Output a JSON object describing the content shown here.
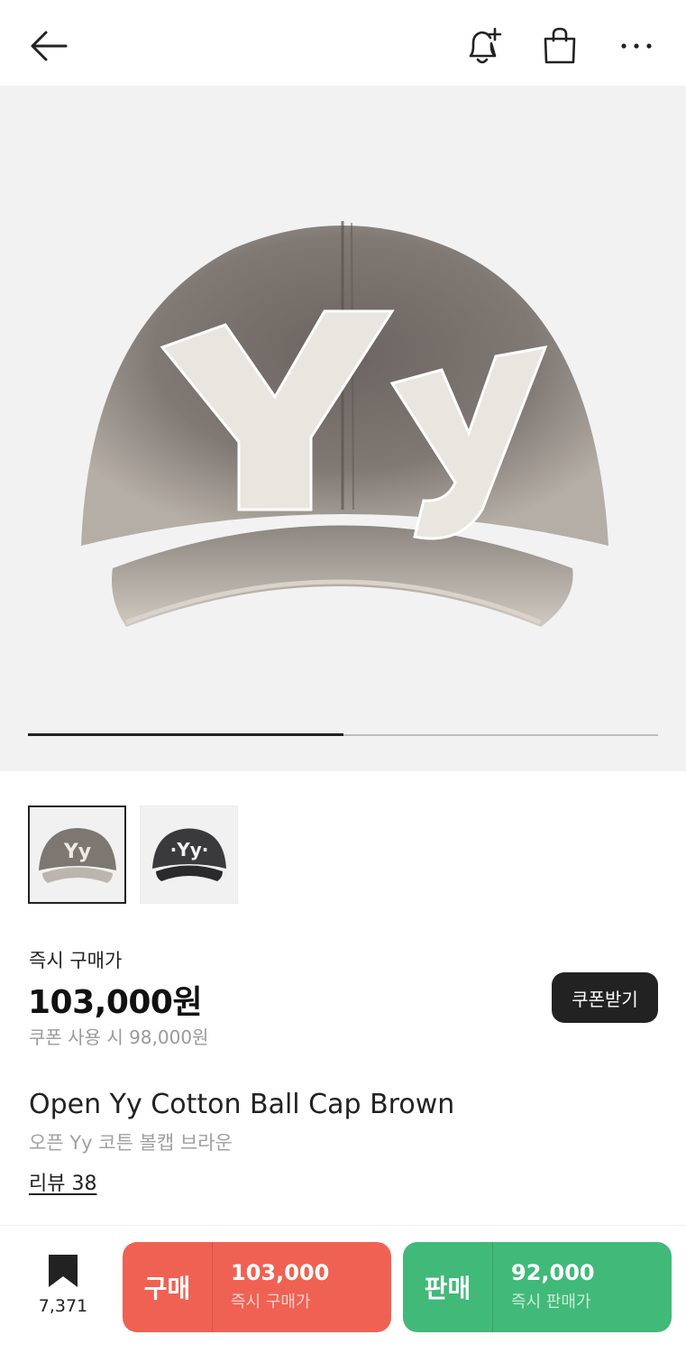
{
  "header": {
    "back_icon": "arrow-left-icon",
    "alert_icon": "bell-plus-icon",
    "cart_icon": "shopping-bag-icon",
    "more_icon": "more-dots-icon"
  },
  "gallery": {
    "progress": 0.5,
    "thumbnails": [
      {
        "name": "washed-gray-cap",
        "selected": true
      },
      {
        "name": "black-cap",
        "selected": false
      }
    ]
  },
  "price": {
    "label": "즉시 구매가",
    "amount": "103,000원",
    "coupon_text": "쿠폰 사용 시 98,000원",
    "coupon_button": "쿠폰받기"
  },
  "product": {
    "title_en": "Open Yy Cotton Ball Cap Brown",
    "title_ko": "오픈 Yy 코튼 볼캡 브라운",
    "review_link": "리뷰 38"
  },
  "bottom_bar": {
    "bookmark_count": "7,371",
    "buy": {
      "kind": "구매",
      "amount": "103,000",
      "sub": "즉시 구매가"
    },
    "sell": {
      "kind": "판매",
      "amount": "92,000",
      "sub": "즉시 판매가"
    }
  },
  "colors": {
    "buy": "#ef6253",
    "sell": "#41b979",
    "dark": "#222222"
  }
}
